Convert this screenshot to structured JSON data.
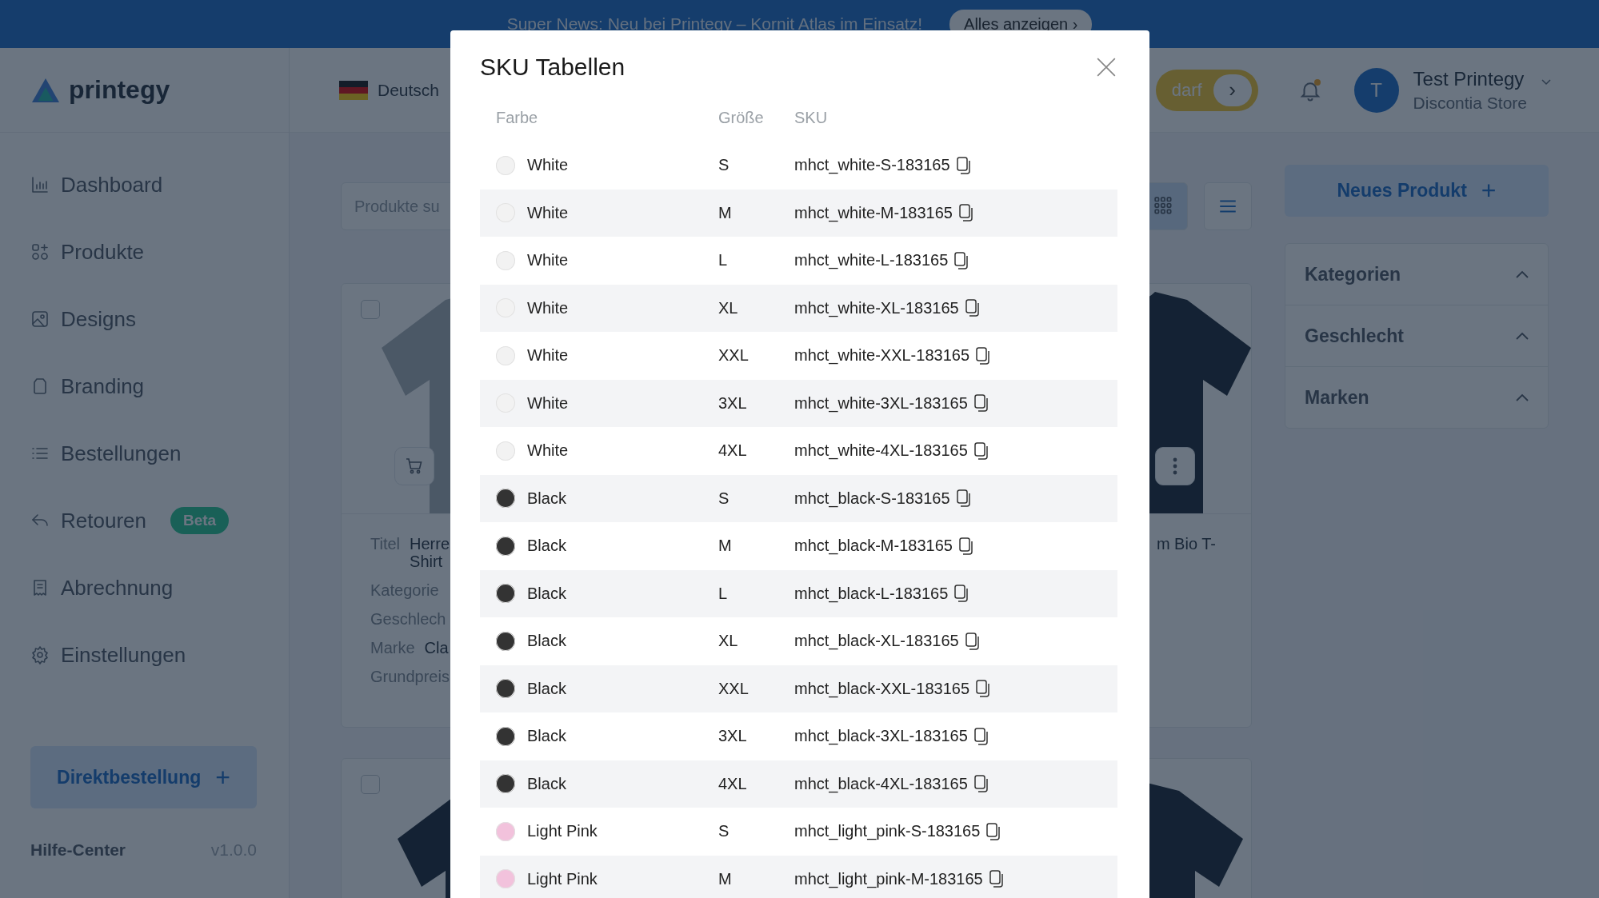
{
  "banner": {
    "text": "Super News: Neu bei Printegy – Kornit Atlas im Einsatz!",
    "button": "Alles anzeigen ›"
  },
  "header": {
    "logo": "printegy",
    "language": "Deutsch",
    "partial_button": "darf",
    "partial_button_arrow": "›",
    "notification_dot": true,
    "user": {
      "initial": "T",
      "name": "Test Printegy",
      "store": "Discontia Store"
    }
  },
  "sidebar": {
    "items": [
      {
        "label": "Dashboard",
        "kind": "chart"
      },
      {
        "label": "Produkte",
        "kind": "shapes"
      },
      {
        "label": "Designs",
        "kind": "image"
      },
      {
        "label": "Branding",
        "kind": "tag"
      },
      {
        "label": "Bestellungen",
        "kind": "list"
      },
      {
        "label": "Retouren",
        "kind": "return",
        "badge": "Beta"
      },
      {
        "label": "Abrechnung",
        "kind": "receipt"
      },
      {
        "label": "Einstellungen",
        "kind": "gear"
      }
    ],
    "direct_order": "Direktbestellung",
    "direct_order_plus": "+",
    "help": "Hilfe-Center",
    "version": "v1.0.0"
  },
  "main": {
    "search_placeholder": "Produkte su",
    "view_buttons": [
      {
        "kind": "grid",
        "selected": true
      },
      {
        "kind": "list",
        "selected": false
      }
    ],
    "product_left": {
      "checked": false,
      "fields": [
        {
          "label": "Titel",
          "value": [
            "Herre",
            "Shirt"
          ]
        },
        {
          "label": "Kategorie"
        },
        {
          "label": "Geschlech"
        },
        {
          "label": "Marke",
          "value": [
            "Cla"
          ]
        },
        {
          "label": "Grundpreis"
        }
      ]
    },
    "product_right": {
      "title_fragment": "m Bio T-"
    },
    "product_lower_left": {
      "checked": false
    }
  },
  "filters": {
    "new_button": "Neues Produkt",
    "new_button_plus": "+",
    "sections": [
      {
        "label": "Kategorien",
        "expanded": true
      },
      {
        "label": "Geschlecht",
        "expanded": true
      },
      {
        "label": "Marken",
        "expanded": true
      }
    ]
  },
  "modal": {
    "title": "SKU Tabellen",
    "columns": [
      "Farbe",
      "Größe",
      "SKU"
    ],
    "rows": [
      {
        "color_name": "White",
        "color": "#f2f2f2",
        "size": "S",
        "sku": "mhct_white-S-183165"
      },
      {
        "color_name": "White",
        "color": "#f2f2f2",
        "size": "M",
        "sku": "mhct_white-M-183165"
      },
      {
        "color_name": "White",
        "color": "#f2f2f2",
        "size": "L",
        "sku": "mhct_white-L-183165"
      },
      {
        "color_name": "White",
        "color": "#f2f2f2",
        "size": "XL",
        "sku": "mhct_white-XL-183165"
      },
      {
        "color_name": "White",
        "color": "#f2f2f2",
        "size": "XXL",
        "sku": "mhct_white-XXL-183165"
      },
      {
        "color_name": "White",
        "color": "#f2f2f2",
        "size": "3XL",
        "sku": "mhct_white-3XL-183165"
      },
      {
        "color_name": "White",
        "color": "#f2f2f2",
        "size": "4XL",
        "sku": "mhct_white-4XL-183165"
      },
      {
        "color_name": "Black",
        "color": "#333333",
        "size": "S",
        "sku": "mhct_black-S-183165"
      },
      {
        "color_name": "Black",
        "color": "#333333",
        "size": "M",
        "sku": "mhct_black-M-183165"
      },
      {
        "color_name": "Black",
        "color": "#333333",
        "size": "L",
        "sku": "mhct_black-L-183165"
      },
      {
        "color_name": "Black",
        "color": "#333333",
        "size": "XL",
        "sku": "mhct_black-XL-183165"
      },
      {
        "color_name": "Black",
        "color": "#333333",
        "size": "XXL",
        "sku": "mhct_black-XXL-183165"
      },
      {
        "color_name": "Black",
        "color": "#333333",
        "size": "3XL",
        "sku": "mhct_black-3XL-183165"
      },
      {
        "color_name": "Black",
        "color": "#333333",
        "size": "4XL",
        "sku": "mhct_black-4XL-183165"
      },
      {
        "color_name": "Light Pink",
        "color": "#f2c2dc",
        "size": "S",
        "sku": "mhct_light_pink-S-183165"
      },
      {
        "color_name": "Light Pink",
        "color": "#f2c2dc",
        "size": "M",
        "sku": "mhct_light_pink-M-183165"
      }
    ]
  }
}
